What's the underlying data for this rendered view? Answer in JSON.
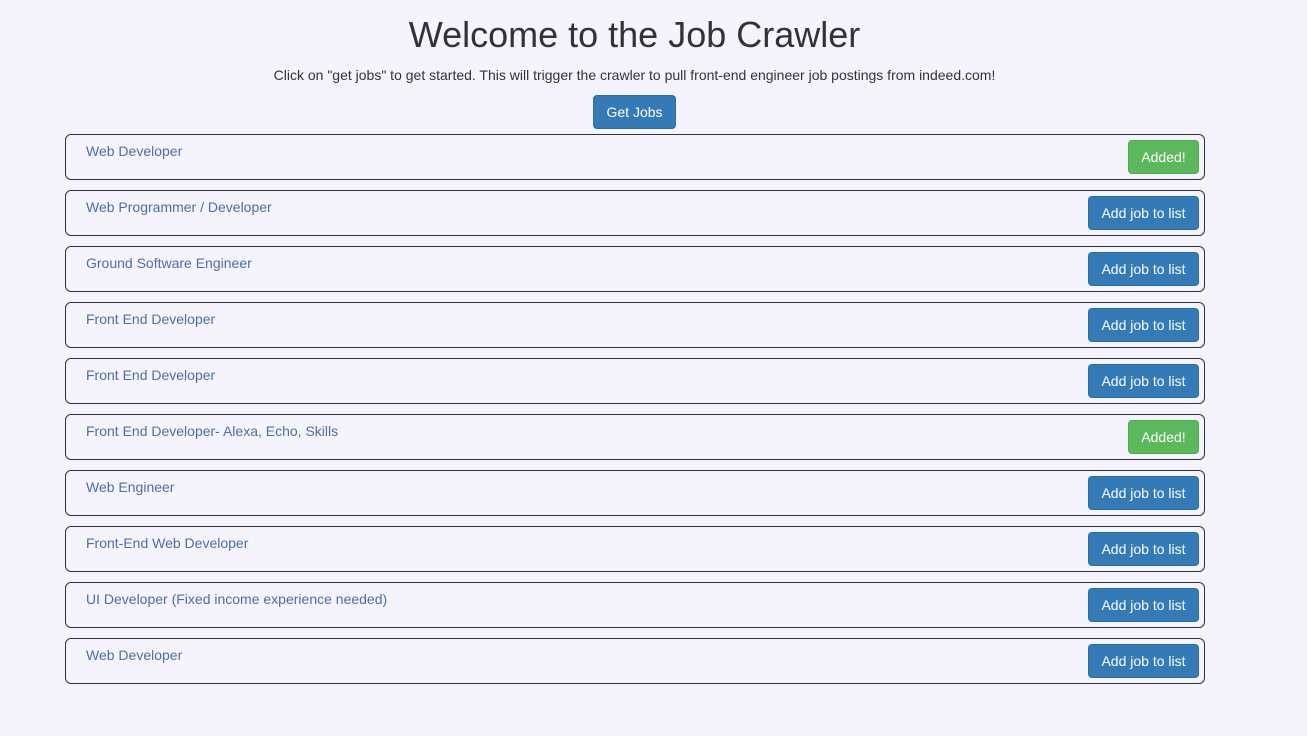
{
  "header": {
    "title": "Welcome to the Job Crawler",
    "subtitle": "Click on \"get jobs\" to get started. This will trigger the crawler to pull front-end engineer job postings from indeed.com!",
    "get_jobs_label": "Get Jobs"
  },
  "colors": {
    "background": "#f5f4fd",
    "primary_button": "#337ab7",
    "success_button": "#5cb85c",
    "job_title_link": "#4a6fa5"
  },
  "jobs": [
    {
      "title": "Web Developer",
      "button_label": "Added!",
      "status": "added"
    },
    {
      "title": "Web Programmer / Developer",
      "button_label": "Add job to list",
      "status": "add"
    },
    {
      "title": "Ground Software Engineer",
      "button_label": "Add job to list",
      "status": "add"
    },
    {
      "title": "Front End Developer",
      "button_label": "Add job to list",
      "status": "add"
    },
    {
      "title": "Front End Developer",
      "button_label": "Add job to list",
      "status": "add"
    },
    {
      "title": "Front End Developer- Alexa, Echo, Skills",
      "button_label": "Added!",
      "status": "added"
    },
    {
      "title": "Web Engineer",
      "button_label": "Add job to list",
      "status": "add"
    },
    {
      "title": "Front-End Web Developer",
      "button_label": "Add job to list",
      "status": "add"
    },
    {
      "title": "UI Developer (Fixed income experience needed)",
      "button_label": "Add job to list",
      "status": "add"
    },
    {
      "title": "Web Developer",
      "button_label": "Add job to list",
      "status": "add"
    }
  ]
}
